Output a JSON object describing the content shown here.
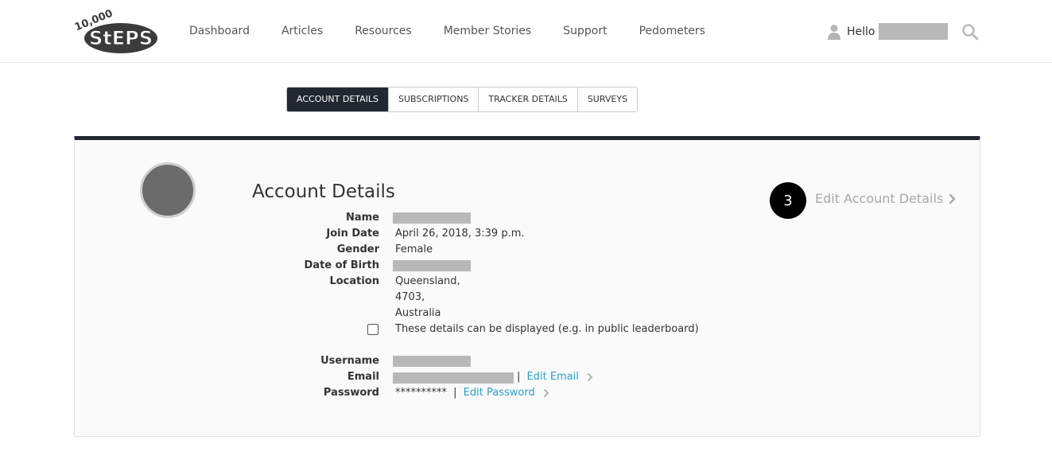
{
  "header": {
    "nav": [
      "Dashboard",
      "Articles",
      "Resources",
      "Member Stories",
      "Support",
      "Pedometers"
    ],
    "hello": "Hello"
  },
  "tabs": [
    "ACCOUNT DETAILS",
    "SUBSCRIPTIONS",
    "TRACKER DETAILS",
    "SURVEYS"
  ],
  "account": {
    "title": "Account Details",
    "step_badge": "3",
    "edit_label": "Edit Account Details",
    "labels": {
      "name": "Name",
      "join_date": "Join Date",
      "gender": "Gender",
      "dob": "Date of Birth",
      "location": "Location",
      "username": "Username",
      "email": "Email",
      "password": "Password"
    },
    "values": {
      "join_date": "April 26, 2018, 3:39 p.m.",
      "gender": "Female",
      "location_1": "Queensland,",
      "location_2": "4703,",
      "location_3": "Australia",
      "display_checkbox_label": "These details can be displayed (e.g. in public leaderboard)",
      "password_mask": "**********",
      "separator": "|",
      "edit_email": "Edit Email",
      "edit_password": "Edit Password"
    }
  },
  "colors": {
    "accent": "#222731",
    "link": "#2aa0d0",
    "redaction": "#b8b8b8"
  },
  "icons": [
    "user-icon",
    "search-icon",
    "chevron-right-icon"
  ]
}
